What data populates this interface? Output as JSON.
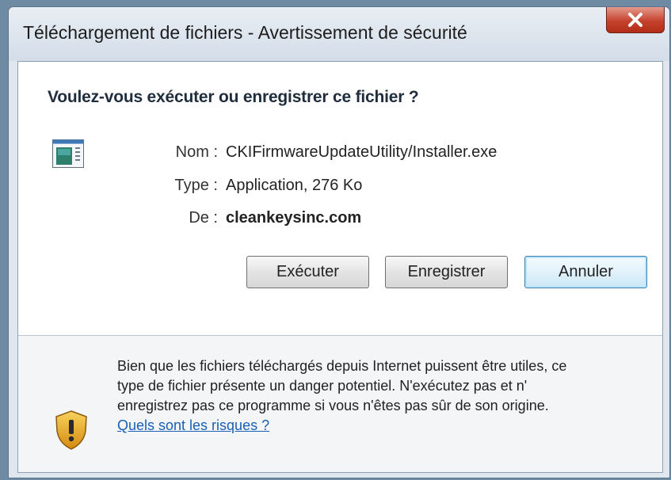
{
  "window": {
    "title": "Téléchargement de fichiers - Avertissement de sécurité",
    "close_icon_glyph": "✕"
  },
  "dialog": {
    "question": "Voulez-vous exécuter ou enregistrer ce fichier ?",
    "file_icon": "application-icon",
    "fields": {
      "name_label": "Nom :",
      "name_value": "CKIFirmwareUpdateUtility/Installer.exe",
      "type_label": "Type :",
      "type_value": "Application, 276 Ko",
      "from_label": "De :",
      "from_value": "cleankeysinc.com"
    },
    "buttons": {
      "run": "Exécuter",
      "save": "Enregistrer",
      "cancel": "Annuler"
    }
  },
  "warning": {
    "icon": "shield-warning-icon",
    "line1": "Bien que les fichiers téléchargés depuis Internet puissent être utiles, ce",
    "line2": "type de fichier présente un danger potentiel. N'exécutez pas et n'",
    "line3": "enregistrez pas ce programme si vous n'êtes pas sûr de son origine.",
    "link": "Quels sont les risques ?"
  },
  "colors": {
    "close_button": "#c4422d",
    "default_button_border": "#3c7fb1",
    "link": "#1a5fb4"
  }
}
